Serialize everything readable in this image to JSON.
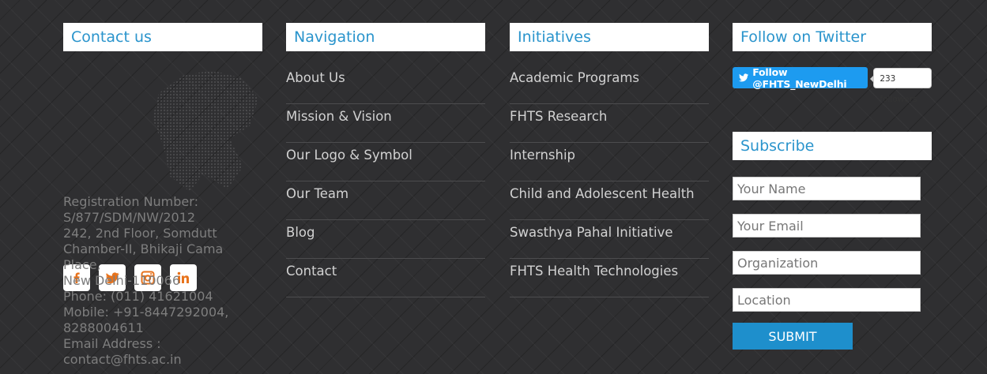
{
  "contact": {
    "heading": "Contact us",
    "lines": [
      "Registration Number:",
      "S/877/SDM/NW/2012",
      "242, 2nd Floor, Somdutt",
      "Chamber-II, Bhikaji Cama Place,",
      "New Delhi-110066",
      "Phone: (011) 41621004",
      "Mobile: +91-8447292004,",
      "8288004611",
      "Email Address :",
      "contact@fhts.ac.in"
    ],
    "socials": [
      {
        "name": "facebook-icon",
        "glyph": "f"
      },
      {
        "name": "twitter-icon",
        "glyph": "twitter"
      },
      {
        "name": "instagram-icon",
        "glyph": "instagram"
      },
      {
        "name": "linkedin-icon",
        "glyph": "in"
      }
    ]
  },
  "navigation": {
    "heading": "Navigation",
    "items": [
      "About Us",
      "Mission & Vision",
      "Our Logo & Symbol",
      "Our Team",
      "Blog",
      "Contact"
    ]
  },
  "initiatives": {
    "heading": "Initiatives",
    "items": [
      "Academic Programs",
      "FHTS Research",
      "Internship",
      "Child and Adolescent Health",
      "Swasthya Pahal Initiative",
      "FHTS Health Technologies"
    ]
  },
  "twitter": {
    "heading": "Follow on Twitter",
    "follow_label": "Follow @FHTS_NewDelhi",
    "followers_label": "233 followers"
  },
  "subscribe": {
    "heading": "Subscribe",
    "fields": [
      "Your Name",
      "Your Email",
      "Organization",
      "Location"
    ],
    "submit_label": "SUBMIT"
  },
  "colors": {
    "accent": "#2a94cc",
    "social_icon": "#e8731c",
    "twitter_blue": "#1d9bf0"
  }
}
